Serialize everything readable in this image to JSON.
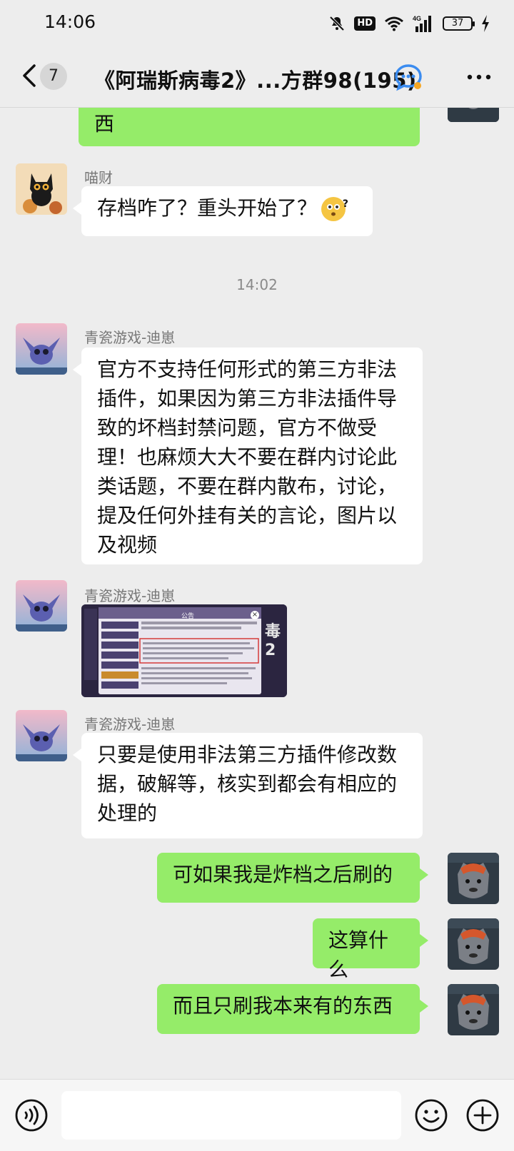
{
  "status_bar": {
    "time": "14:06",
    "network": "4G",
    "hd": "HD",
    "battery": "37"
  },
  "header": {
    "back_badge": "7",
    "title": "《阿瑞斯病毒2》...方群98(195)"
  },
  "messages": [
    {
      "type": "text",
      "direction": "out",
      "text": "西",
      "partial": true
    },
    {
      "type": "text",
      "direction": "in",
      "sender": "喵财",
      "text": "存档咋了？重头开始了？"
    },
    {
      "type": "time",
      "text": "14:02"
    },
    {
      "type": "text",
      "direction": "in",
      "sender": "青瓷游戏-迪崽",
      "text": "官方不支持任何形式的第三方非法插件，如果因为第三方非法插件导致的坏档封禁问题，官方不做受理！也麻烦大大不要在群内讨论此类话题，不要在群内散布，讨论，提及任何外挂有关的言论，图片以及视频"
    },
    {
      "type": "image",
      "direction": "in",
      "sender": "青瓷游戏-迪崽",
      "image_title": "公告",
      "image_badge": "毒2"
    },
    {
      "type": "text",
      "direction": "in",
      "sender": "青瓷游戏-迪崽",
      "text": "只要是使用非法第三方插件修改数据，破解等，核实到都会有相应的处理的"
    },
    {
      "type": "text",
      "direction": "out",
      "text": "可如果我是炸档之后刷的"
    },
    {
      "type": "text",
      "direction": "out",
      "text": "这算什么"
    },
    {
      "type": "text",
      "direction": "out",
      "text": "而且只刷我本来有的东西"
    }
  ],
  "input": {
    "placeholder": ""
  },
  "colors": {
    "out_bubble": "#95ec69",
    "in_bubble": "#ffffff",
    "background": "#ededed"
  },
  "icons": [
    "mute-icon",
    "wifi-icon",
    "signal-icon",
    "charging-icon",
    "back-icon",
    "service-icon",
    "more-icon",
    "voice-icon",
    "emoji-icon",
    "plus-icon"
  ]
}
